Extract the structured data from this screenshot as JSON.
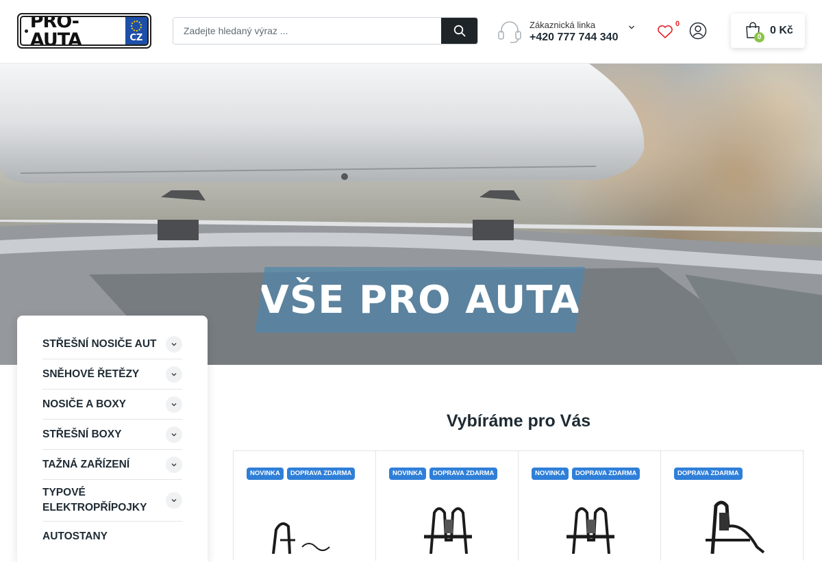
{
  "header": {
    "logo": {
      "text": "PRO-AUTA",
      "country": "CZ"
    },
    "search": {
      "placeholder": "Zadejte hledaný výraz ..."
    },
    "hotline": {
      "label": "Zákaznická linka",
      "phone": "+420 777 744 340"
    },
    "wishlist": {
      "count": "0"
    },
    "cart": {
      "count": "0",
      "total": "0 Kč"
    }
  },
  "hero": {
    "banner_text": "VŠE PRO AUTA"
  },
  "sidebar": {
    "categories": [
      {
        "label": "STŘEŠNÍ NOSIČE AUT"
      },
      {
        "label": "SNĚHOVÉ ŘETĚZY"
      },
      {
        "label": "NOSIČE A BOXY"
      },
      {
        "label": "STŘEŠNÍ BOXY"
      },
      {
        "label": "TAŽNÁ ZAŘÍZENÍ"
      },
      {
        "label": "TYPOVÉ ELEKTROPŘÍPOJKY"
      },
      {
        "label": "AUTOSTANY"
      }
    ]
  },
  "recommended": {
    "title": "Vybíráme pro Vás",
    "products": [
      {
        "badges": [
          "NOVINKA",
          "DOPRAVA ZDARMA"
        ]
      },
      {
        "badges": [
          "NOVINKA",
          "DOPRAVA ZDARMA"
        ]
      },
      {
        "badges": [
          "NOVINKA",
          "DOPRAVA ZDARMA"
        ]
      },
      {
        "badges": [
          "DOPRAVA ZDARMA"
        ]
      }
    ]
  },
  "colors": {
    "badge": "#2f7fd8",
    "cart_badge": "#8bc34a",
    "wishlist_count": "#e8202a",
    "search_button": "#1e2428"
  }
}
